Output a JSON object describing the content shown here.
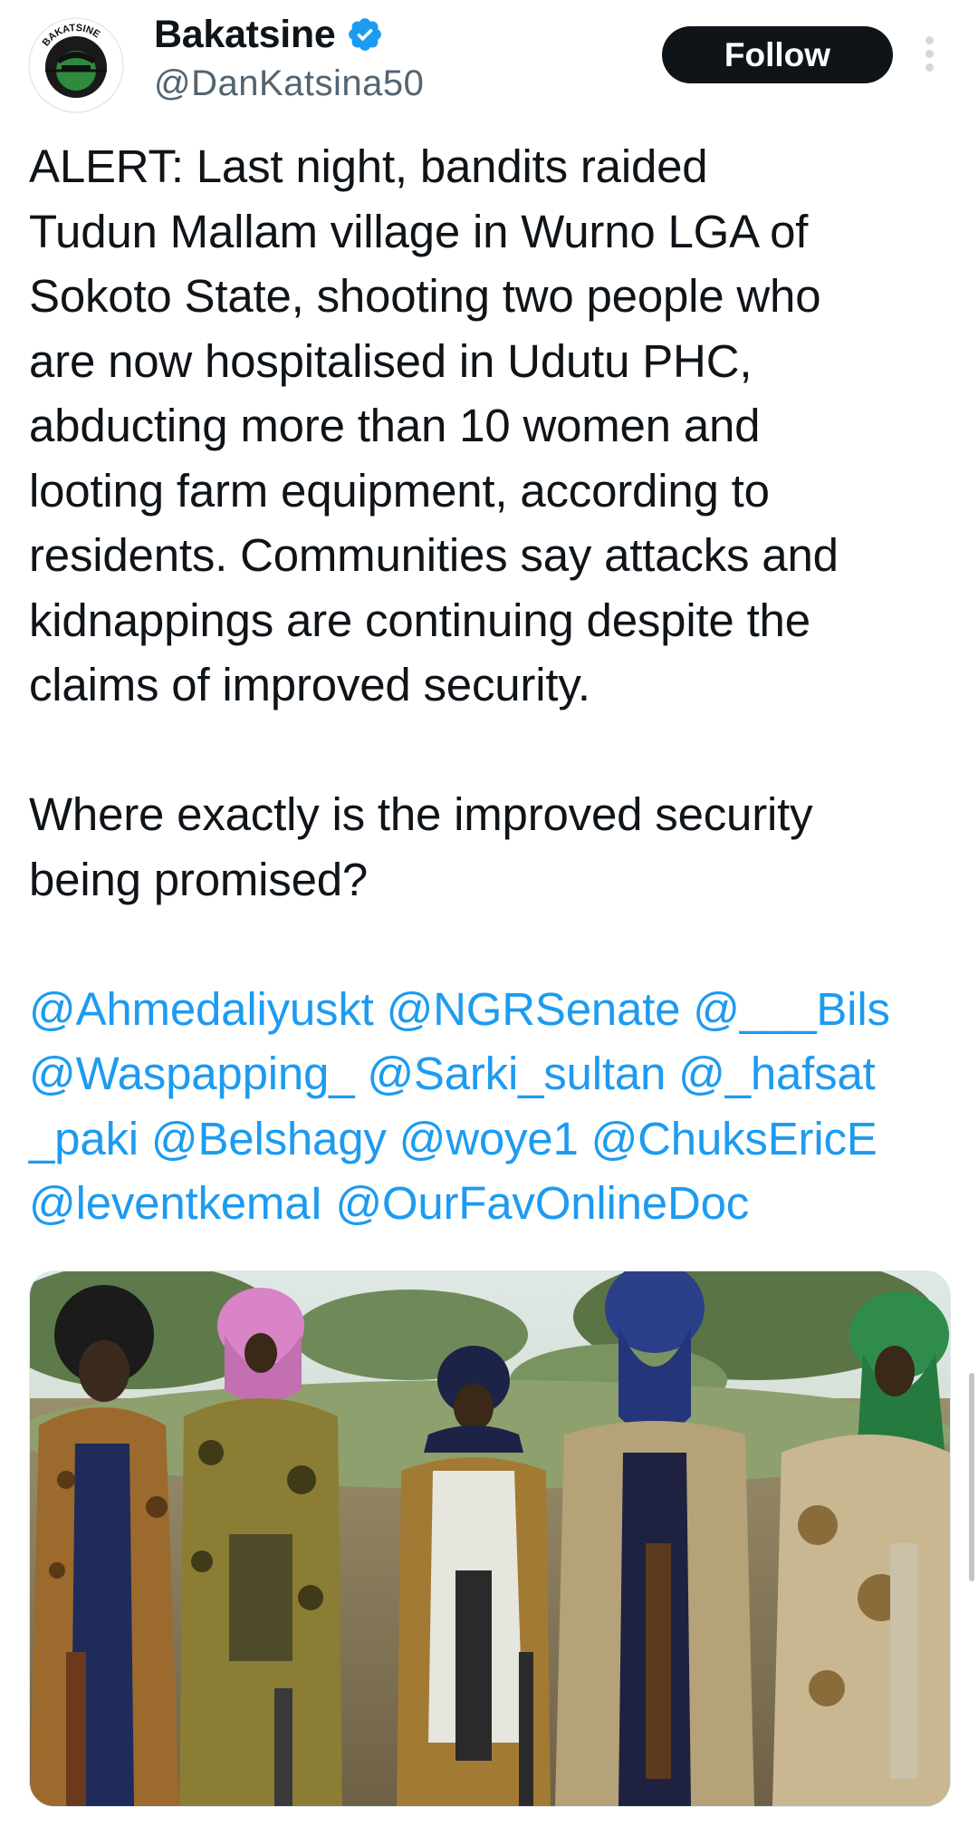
{
  "author": {
    "display_name": "Bakatsine",
    "handle": "@DanKatsina50",
    "avatar_text": "BAKATSINE",
    "verified_icon": "verified-badge-icon"
  },
  "actions": {
    "follow_label": "Follow",
    "more_icon": "more-vertical-icon"
  },
  "tweet": {
    "alert_word": "ALERT",
    "lines": [
      ": Last night, bandits raided",
      "Tudun Mallam village in Wurno LGA of",
      "Sokoto State, shooting two people who",
      "are now hospitalised in Udutu PHC,",
      "abducting more than 10 women and",
      "looting farm equipment, according to",
      "residents. Communities say attacks and",
      "kidnappings are continuing despite the",
      "claims of improved security."
    ],
    "question_lines": [
      "Where exactly is the improved security",
      "being promised?"
    ],
    "mention_lines": [
      "@Ahmedaliyuskt @NGRSenate @___Bils",
      "@Waspapping_ @Sarki_sultan @_hafsat",
      "_paki @Belshagy @woye1 @ChuksEricE",
      "@leventkemaI @OurFavOnlineDoc"
    ]
  },
  "colors": {
    "text": "#0f1419",
    "secondary": "#536471",
    "link": "#1d9bf0",
    "button_bg": "#0f1419",
    "verified": "#1d9bf0"
  },
  "media": {
    "description_icon": "photo-of-armed-men-image"
  }
}
